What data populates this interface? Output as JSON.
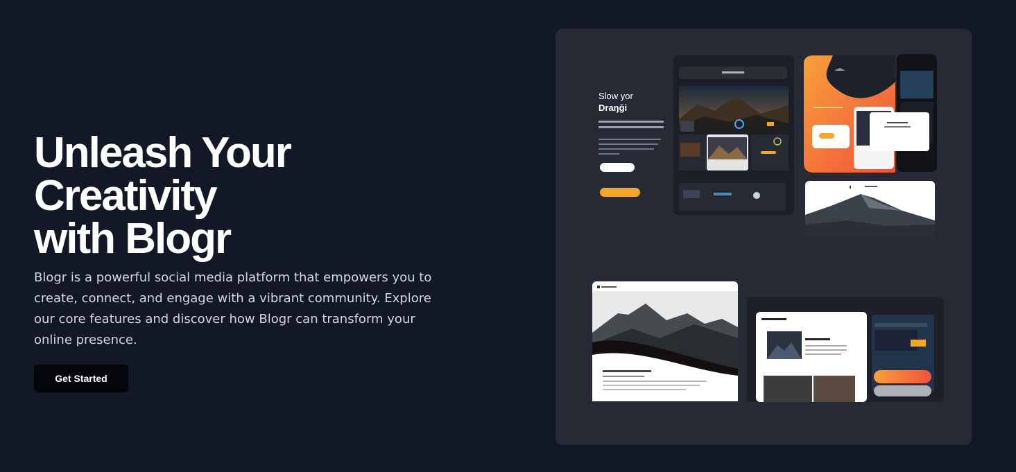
{
  "hero": {
    "title_line1": "Unleash Your Creativity",
    "title_line2": "with Blogr",
    "description": "Blogr is a powerful social media platform that empowers you to create, connect, and engage with a vibrant community. Explore our core features and discover how Blogr can transform your online presence.",
    "cta_label": "Get Started"
  },
  "showcase": {
    "mock_heading_line1": "Slow yor",
    "mock_heading_line2": "Draŋği"
  },
  "colors": {
    "background": "#131827",
    "panel": "#262a34",
    "accent_orange": "#f5a623",
    "cta_background": "#04060c"
  }
}
